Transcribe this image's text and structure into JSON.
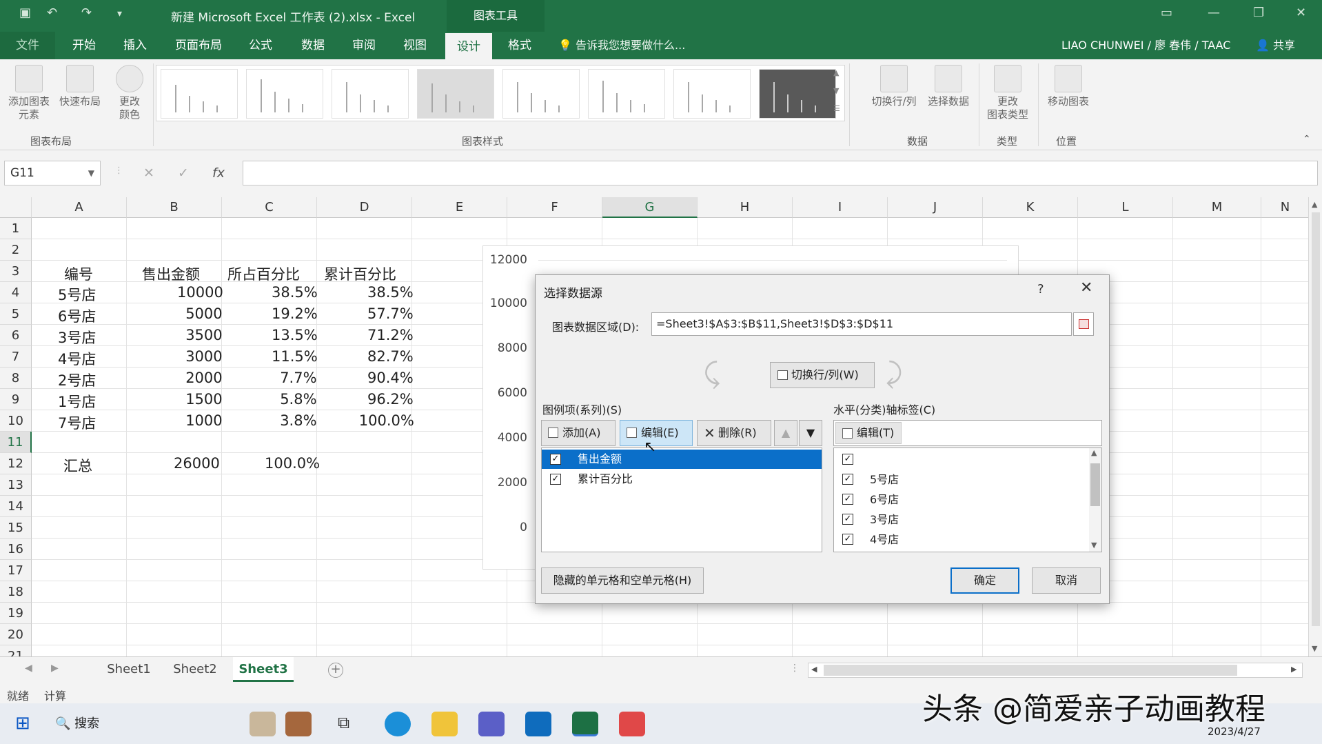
{
  "titlebar": {
    "title": "新建 Microsoft Excel 工作表 (2).xlsx - Excel",
    "context_tab": "图表工具"
  },
  "tabs": [
    "文件",
    "开始",
    "插入",
    "页面布局",
    "公式",
    "数据",
    "审阅",
    "视图",
    "设计",
    "格式"
  ],
  "tell_me": "告诉我您想要做什么...",
  "user": "LIAO CHUNWEI / 廖 春伟 / TAAC",
  "share": "共享",
  "ribbon": {
    "add_element": [
      "添加图表",
      "元素"
    ],
    "quick_layout": "快速布局",
    "change_color": [
      "更改",
      "颜色"
    ],
    "group_layout": "图表布局",
    "group_styles": "图表样式",
    "switch_rowcol": "切换行/列",
    "select_data": "选择数据",
    "group_data": "数据",
    "change_type": [
      "更改",
      "图表类型"
    ],
    "group_type": "类型",
    "move_chart": "移动图表",
    "group_location": "位置"
  },
  "formula": {
    "namebox": "G11",
    "fx": "fx"
  },
  "columns": [
    "A",
    "B",
    "C",
    "D",
    "E",
    "F",
    "G",
    "H",
    "I",
    "J",
    "K",
    "L",
    "M",
    "N"
  ],
  "rows": [
    "1",
    "2",
    "3",
    "4",
    "5",
    "6",
    "7",
    "8",
    "9",
    "10",
    "11",
    "12",
    "13",
    "14",
    "15",
    "16",
    "17",
    "18",
    "19",
    "20",
    "21"
  ],
  "table": {
    "headers": [
      "编号",
      "售出金额",
      "所占百分比",
      "累计百分比"
    ],
    "data": [
      [
        "5号店",
        "10000",
        "38.5%",
        "38.5%"
      ],
      [
        "6号店",
        "5000",
        "19.2%",
        "57.7%"
      ],
      [
        "3号店",
        "3500",
        "13.5%",
        "71.2%"
      ],
      [
        "4号店",
        "3000",
        "11.5%",
        "82.7%"
      ],
      [
        "2号店",
        "2000",
        "7.7%",
        "90.4%"
      ],
      [
        "1号店",
        "1500",
        "5.8%",
        "96.2%"
      ],
      [
        "7号店",
        "1000",
        "3.8%",
        "100.0%"
      ]
    ],
    "total": [
      "汇总",
      "26000",
      "100.0%"
    ]
  },
  "chart": {
    "yticks": [
      "12000",
      "10000",
      "8000",
      "6000",
      "4000",
      "2000",
      "0"
    ]
  },
  "dialog": {
    "title": "选择数据源",
    "help": "?",
    "range_label": "图表数据区域(D):",
    "range_value": "=Sheet3!$A$3:$B$11,Sheet3!$D$3:$D$11",
    "switch": "切换行/列(W)",
    "legend_label": "图例项(系列)(S)",
    "add": "添加(A)",
    "edit": "编辑(E)",
    "delete": "删除(R)",
    "series": [
      "售出金额",
      "累计百分比"
    ],
    "axis_label": "水平(分类)轴标签(C)",
    "axis_edit": "编辑(T)",
    "axis_items": [
      "",
      "5号店",
      "6号店",
      "3号店",
      "4号店"
    ],
    "hidden": "隐藏的单元格和空单元格(H)",
    "ok": "确定",
    "cancel": "取消"
  },
  "sheets": [
    "Sheet1",
    "Sheet2",
    "Sheet3"
  ],
  "status": [
    "就绪",
    "计算"
  ],
  "taskbar": {
    "search": "搜索",
    "date": "2023/4/27"
  },
  "watermark": "头条 @简爱亲子动画教程",
  "colors": {
    "excel_green": "#217346",
    "selection_blue": "#0b6fc9"
  }
}
